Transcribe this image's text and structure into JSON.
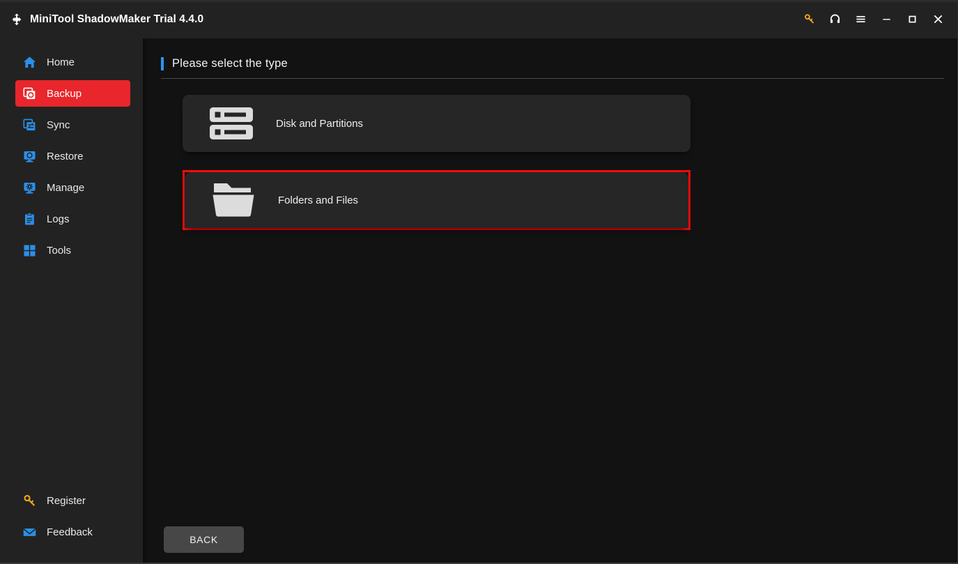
{
  "window": {
    "title": "MiniTool ShadowMaker Trial 4.4.0",
    "logo_icon": "shadowmaker-logo-icon",
    "controls": [
      {
        "name": "register-key-icon",
        "label": "Register",
        "color": "#f0a71e"
      },
      {
        "name": "support-headset-icon",
        "label": "Support",
        "color": "#ffffff"
      },
      {
        "name": "menu-hamburger-icon",
        "label": "Menu",
        "color": "#ffffff"
      },
      {
        "name": "minimize-icon",
        "label": "Minimize",
        "color": "#ffffff"
      },
      {
        "name": "maximize-icon",
        "label": "Maximize",
        "color": "#ffffff"
      },
      {
        "name": "close-icon",
        "label": "Close",
        "color": "#ffffff"
      }
    ]
  },
  "sidebar": {
    "items": [
      {
        "label": "Home",
        "icon": "home-icon",
        "active": false
      },
      {
        "label": "Backup",
        "icon": "backup-icon",
        "active": true
      },
      {
        "label": "Sync",
        "icon": "sync-icon",
        "active": false
      },
      {
        "label": "Restore",
        "icon": "restore-icon",
        "active": false
      },
      {
        "label": "Manage",
        "icon": "manage-icon",
        "active": false
      },
      {
        "label": "Logs",
        "icon": "logs-icon",
        "active": false
      },
      {
        "label": "Tools",
        "icon": "tools-icon",
        "active": false
      }
    ],
    "bottom_items": [
      {
        "label": "Register",
        "icon": "key-icon"
      },
      {
        "label": "Feedback",
        "icon": "envelope-icon"
      }
    ],
    "active_color": "#e8262b",
    "icon_color": "#2b8fe8"
  },
  "main": {
    "header": "Please select the type",
    "accent_color": "#2b96f1",
    "options": [
      {
        "label": "Disk and Partitions",
        "icon": "disk-partitions-icon",
        "selected": false
      },
      {
        "label": "Folders and Files",
        "icon": "folder-icon",
        "selected": true
      }
    ],
    "selection_border_color": "#fb0b0b",
    "back_label": "BACK"
  }
}
